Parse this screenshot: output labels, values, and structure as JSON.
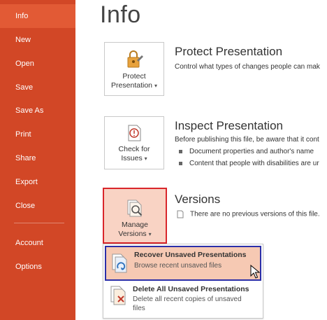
{
  "sidebar": {
    "items": [
      {
        "label": "Info"
      },
      {
        "label": "New"
      },
      {
        "label": "Open"
      },
      {
        "label": "Save"
      },
      {
        "label": "Save As"
      },
      {
        "label": "Print"
      },
      {
        "label": "Share"
      },
      {
        "label": "Export"
      },
      {
        "label": "Close"
      },
      {
        "label": "Account"
      },
      {
        "label": "Options"
      }
    ],
    "active": "Info"
  },
  "main": {
    "title": "Info",
    "protect": {
      "tile_line1": "Protect",
      "tile_line2": "Presentation",
      "title": "Protect Presentation",
      "desc": "Control what types of changes people can mak"
    },
    "inspect": {
      "tile_line1": "Check for",
      "tile_line2": "Issues",
      "title": "Inspect Presentation",
      "desc": "Before publishing this file, be aware that it cont",
      "bullets": [
        "Document properties and author's name",
        "Content that people with disabilities are ur"
      ]
    },
    "versions": {
      "tile_line1": "Manage",
      "tile_line2": "Versions",
      "title": "Versions",
      "desc": "There are no previous versions of this file."
    }
  },
  "dropdown": {
    "items": [
      {
        "title": "Recover Unsaved Presentations",
        "desc": "Browse recent unsaved files",
        "icon": "recover-icon"
      },
      {
        "title": "Delete All Unsaved Presentations",
        "desc": "Delete all recent copies of unsaved files",
        "icon": "delete-files-icon"
      }
    ]
  },
  "colors": {
    "sidebar": "#d24726",
    "sidebar_active": "#e25a35",
    "highlight_red": "#d9262b",
    "highlight_blue": "#2b2fa8",
    "hover_fill": "#f6c9b3"
  }
}
